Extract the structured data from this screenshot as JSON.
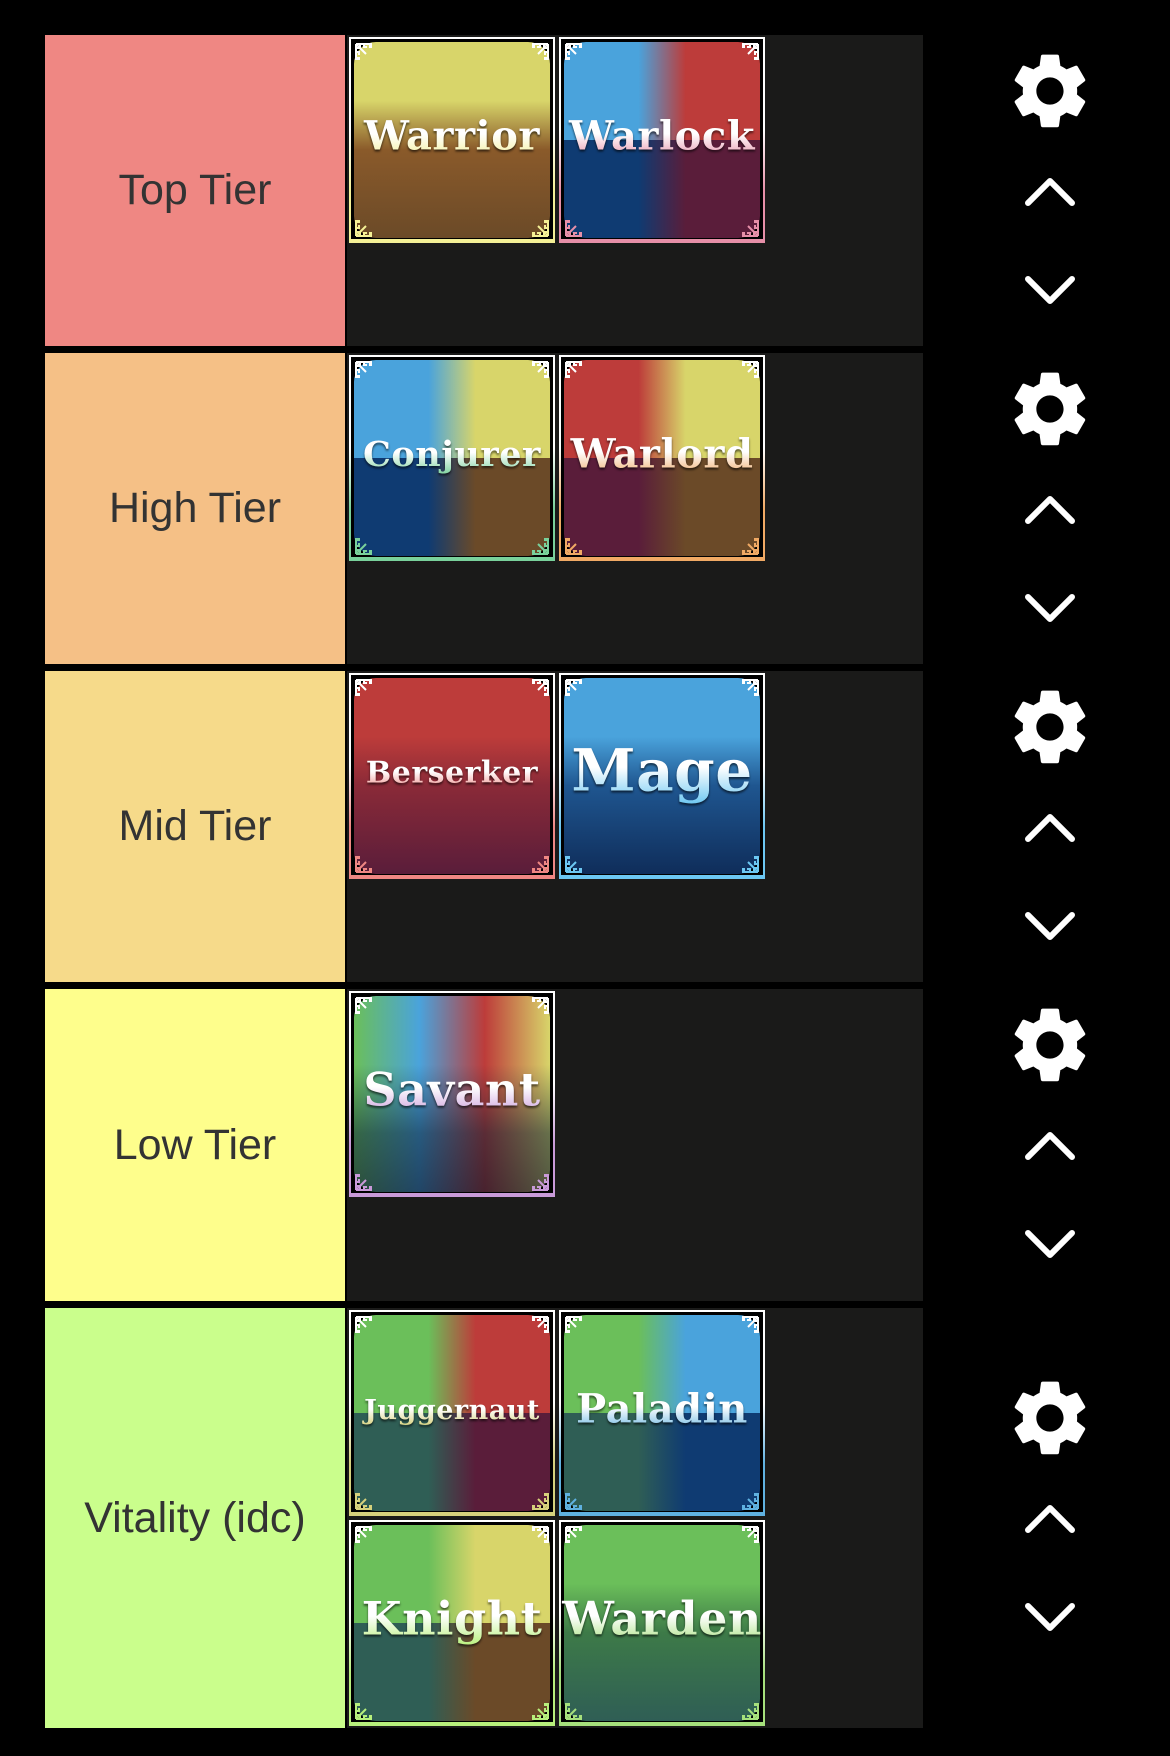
{
  "tiers": [
    {
      "label": "Top Tier",
      "color": "#ef8783",
      "items": [
        {
          "name": "Warrior",
          "accent": "#f4f096",
          "colors": [
            "#d8d56a",
            "#8a5a2a",
            "#6b4a28"
          ],
          "layout": "vertical"
        },
        {
          "name": "Warlock",
          "accent": "#e68fa8",
          "colors": [
            "#4aa3dc",
            "#bd3c3a",
            "#0f3b72",
            "#5a1d3a"
          ],
          "layout": "quad"
        }
      ]
    },
    {
      "label": "High Tier",
      "color": "#f5c086",
      "items": [
        {
          "name": "Conjurer",
          "accent": "#79d19b",
          "colors": [
            "#4aa3dc",
            "#d8d56a",
            "#0f3b72",
            "#6b4a28"
          ],
          "layout": "quad"
        },
        {
          "name": "Warlord",
          "accent": "#f0a964",
          "colors": [
            "#bd3c3a",
            "#d8d56a",
            "#5a1d3a",
            "#6b4a28"
          ],
          "layout": "quad"
        }
      ]
    },
    {
      "label": "Mid Tier",
      "color": "#f6da8a",
      "items": [
        {
          "name": "Berserker",
          "accent": "#ef8783",
          "colors": [
            "#bd3c3a",
            "#8a2a38",
            "#5a1d3a"
          ],
          "layout": "vertical"
        },
        {
          "name": "Mage",
          "accent": "#6cc7f2",
          "colors": [
            "#4aa3dc",
            "#1f5690",
            "#0f2d5a"
          ],
          "layout": "vertical"
        }
      ]
    },
    {
      "label": "Low Tier",
      "color": "#fefe8c",
      "items": [
        {
          "name": "Savant",
          "accent": "#c99ad9",
          "colors": [
            "#6bbf5a",
            "#4aa3dc",
            "#bd3c3a",
            "#d8d56a"
          ],
          "layout": "stripes"
        }
      ]
    },
    {
      "label": "Vitality (idc)",
      "color": "#cafe8c",
      "items": [
        {
          "name": "Juggernaut",
          "accent": "#d6d17c",
          "colors": [
            "#6bbf5a",
            "#bd3c3a",
            "#2f5e55",
            "#5a1d3a"
          ],
          "layout": "quad"
        },
        {
          "name": "Paladin",
          "accent": "#5fb1e0",
          "colors": [
            "#6bbf5a",
            "#4aa3dc",
            "#2f5e55",
            "#0f3b72"
          ],
          "layout": "quad"
        },
        {
          "name": "Knight",
          "accent": "#b8f07c",
          "colors": [
            "#6bbf5a",
            "#d8d56a",
            "#2f5e55",
            "#6b4a28"
          ],
          "layout": "quad"
        },
        {
          "name": "Warden",
          "accent": "#a6e07c",
          "colors": [
            "#6bbf5a",
            "#3d7a48",
            "#2f5e55"
          ],
          "layout": "vertical"
        }
      ]
    }
  ],
  "controls": {
    "settings_icon": "gear-icon",
    "move_up_icon": "chevron-up-icon",
    "move_down_icon": "chevron-down-icon"
  }
}
